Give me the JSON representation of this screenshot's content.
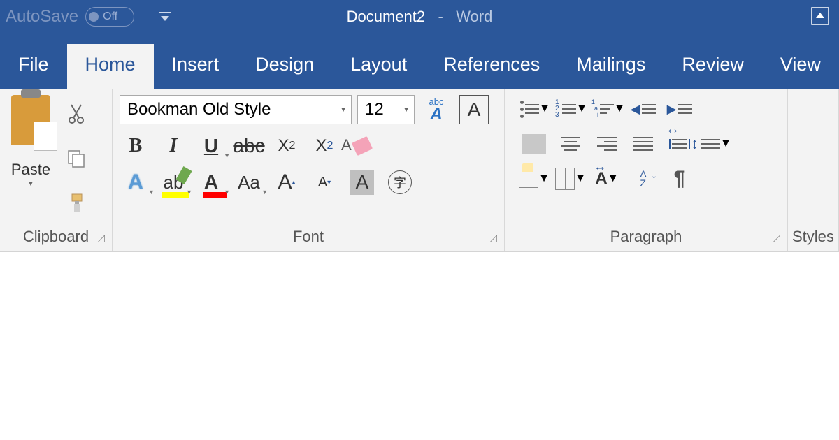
{
  "titlebar": {
    "autosave_label": "AutoSave",
    "autosave_state": "Off",
    "doc_name": "Document2",
    "app_name": "Word",
    "separator": "-"
  },
  "tabs": {
    "file": "File",
    "home": "Home",
    "insert": "Insert",
    "design": "Design",
    "layout": "Layout",
    "references": "References",
    "mailings": "Mailings",
    "review": "Review",
    "view": "View"
  },
  "clipboard": {
    "paste": "Paste",
    "group_label": "Clipboard"
  },
  "font": {
    "name": "Bookman Old Style",
    "size": "12",
    "bold": "B",
    "italic": "I",
    "underline": "U",
    "strike": "abc",
    "subscript": "X",
    "subscript_sub": "2",
    "superscript": "X",
    "superscript_sup": "2",
    "clear_abc": "abc",
    "clear_A": "A",
    "boxed_A": "A",
    "text_effects": "A",
    "highlight": "ab",
    "font_color": "A",
    "change_case": "Aa",
    "grow": "A",
    "shrink": "A",
    "shading": "A",
    "enclosed": "字",
    "group_label": "Font"
  },
  "paragraph": {
    "group_label": "Paragraph",
    "sort_a": "A",
    "sort_z": "Z",
    "pilcrow": "¶",
    "asian": "A",
    "num1": "1",
    "num2": "2",
    "num3": "3",
    "ml1": "1",
    "mla": "a",
    "mli": "i"
  },
  "styles": {
    "group_label": "Styles"
  }
}
